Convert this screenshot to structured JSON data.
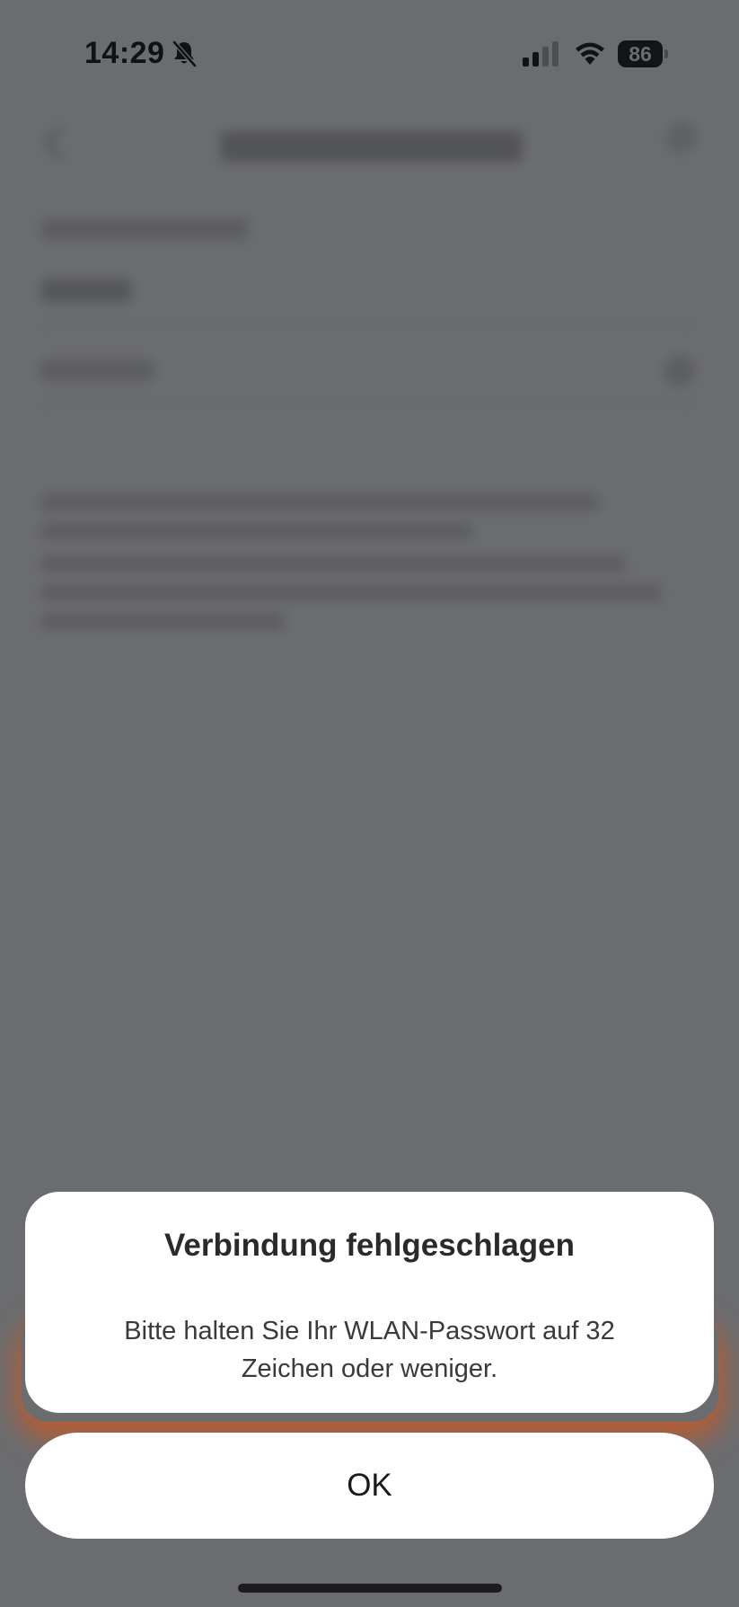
{
  "status_bar": {
    "time": "14:29",
    "battery_level": "86",
    "icons": [
      "bell-slash-icon",
      "cellular-signal-icon",
      "wifi-icon",
      "battery-icon"
    ]
  },
  "dialog": {
    "title": "Verbindung fehlgeschlagen",
    "message": "Bitte halten Sie Ihr WLAN-Passwort auf 32 Zeichen oder weniger.",
    "ok_label": "OK"
  },
  "colors": {
    "overlay_background": "#6b6c6f",
    "dialog_background": "#ffffff",
    "glow_accent": "#d6581c"
  }
}
